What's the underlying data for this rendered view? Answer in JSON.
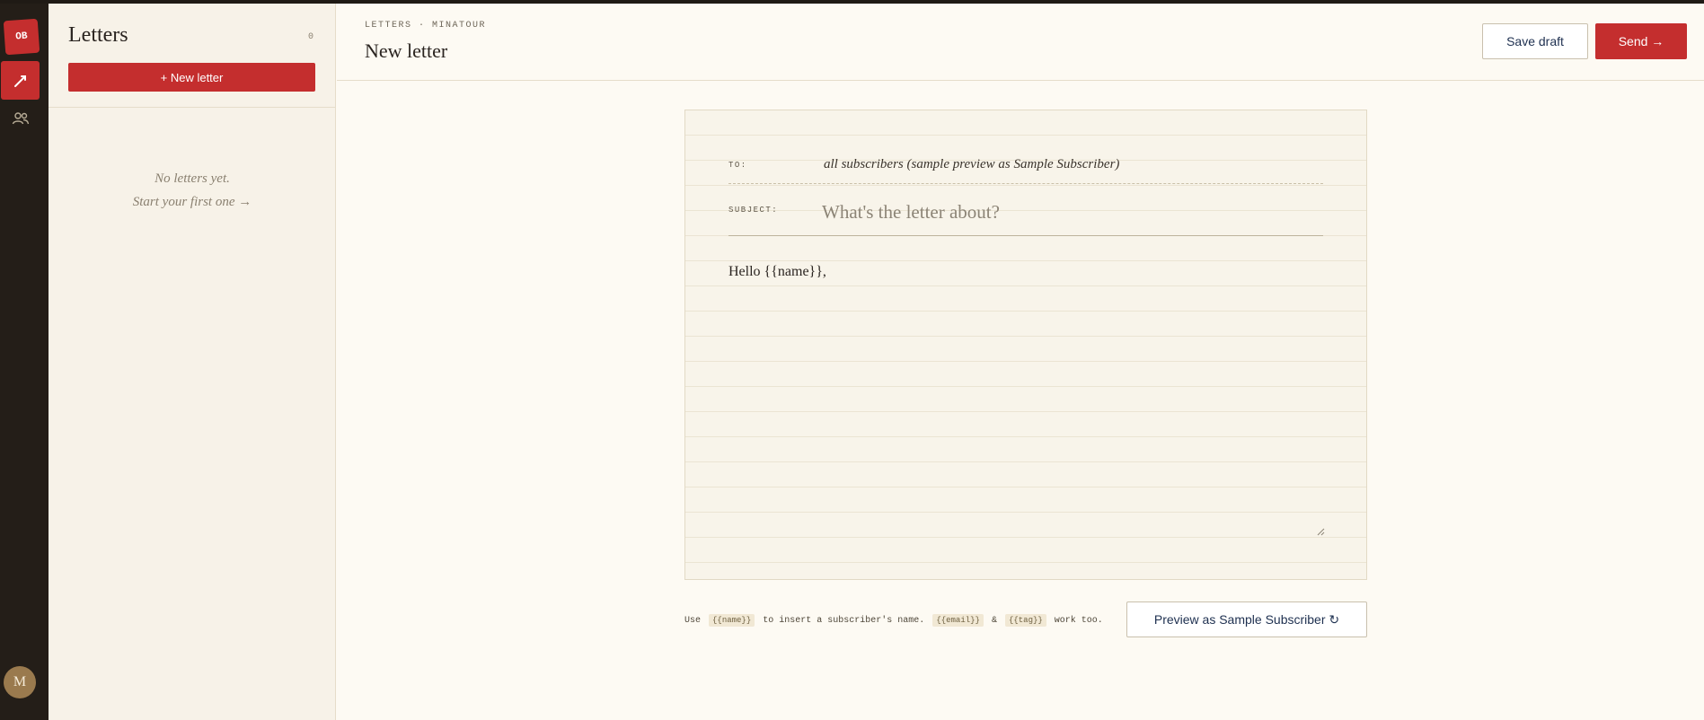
{
  "rail": {
    "logo": "OB",
    "avatar_initial": "M"
  },
  "list": {
    "title": "Letters",
    "count": "0",
    "new_button": "+ New letter",
    "empty_line1": "No letters yet.",
    "empty_line2": "Start your first one →"
  },
  "header": {
    "breadcrumb": "LETTERS · MINATOUR",
    "title": "New letter",
    "save_label": "Save draft",
    "send_label": "Send →"
  },
  "letter": {
    "to_label": "TO:",
    "to_value": "all subscribers (sample preview as Sample Subscriber)",
    "subject_label": "SUBJECT:",
    "subject_value": "",
    "subject_placeholder": "What's the letter about?",
    "body": "Hello {{name}},"
  },
  "footer": {
    "hint_prefix": "Use",
    "token_name": "{{name}}",
    "hint_middle": "to insert a subscriber's name.",
    "token_email": "{{email}}",
    "hint_amp": "&",
    "token_tag": "{{tag}}",
    "hint_suffix": "work too.",
    "preview_label": "Preview as Sample Subscriber ↻"
  },
  "colors": {
    "accent": "#c42e2e",
    "rail": "#241e18",
    "paper": "#f8f4ea",
    "background": "#fdfaf3",
    "button_text": "#1e3050"
  },
  "icons": {
    "compose": "pen-icon",
    "subscribers": "people-icon"
  }
}
